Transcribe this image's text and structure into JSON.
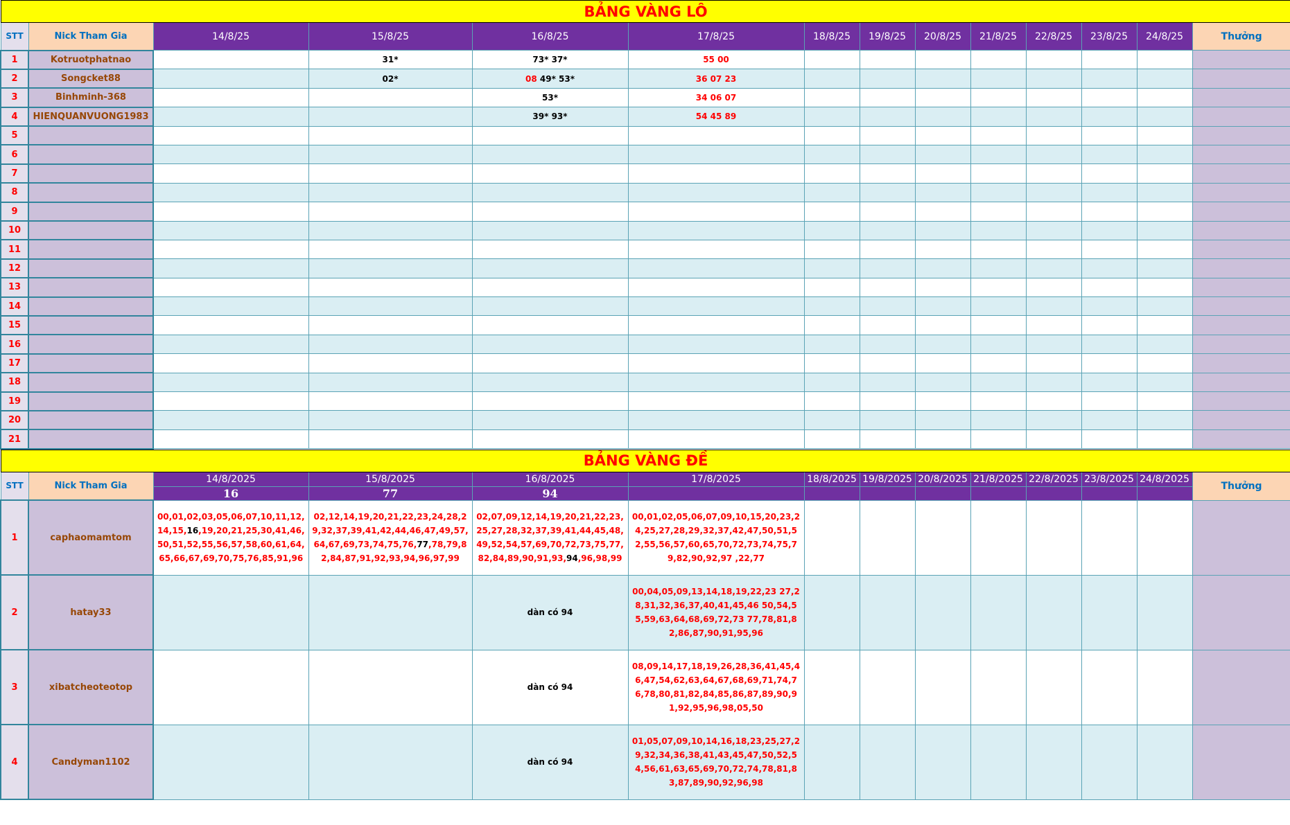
{
  "lo": {
    "title": "BẢNG VÀNG LÔ",
    "hdr_stt": "STT",
    "hdr_nick": "Nick Tham Gia",
    "dates": [
      "14/8/25",
      "15/8/25",
      "16/8/25",
      "17/8/25",
      "18/8/25",
      "19/8/25",
      "20/8/25",
      "21/8/25",
      "22/8/25",
      "23/8/25",
      "24/8/25"
    ],
    "hdr_thuong": "Thưởng",
    "rows": [
      {
        "stt": "1",
        "nick": "Kotruotphatnao",
        "cells": [
          [],
          [
            {
              "t": "31*",
              "c": "blk"
            }
          ],
          [
            {
              "t": "73* 37*",
              "c": "blk"
            }
          ],
          [
            {
              "t": "55 00",
              "c": "red"
            }
          ]
        ]
      },
      {
        "stt": "2",
        "nick": "Songcket88",
        "cells": [
          [],
          [
            {
              "t": "02*",
              "c": "blk"
            }
          ],
          [
            {
              "t": "08",
              "c": "red"
            },
            {
              "t": " 49* 53*",
              "c": "blk"
            }
          ],
          [
            {
              "t": "36 07 23",
              "c": "red"
            }
          ]
        ]
      },
      {
        "stt": "3",
        "nick": "Binhminh-368",
        "cells": [
          [],
          [],
          [
            {
              "t": "53*",
              "c": "blk"
            }
          ],
          [
            {
              "t": "34 06 07",
              "c": "red"
            }
          ]
        ]
      },
      {
        "stt": "4",
        "nick": "HIENQUANVUONG1983",
        "cells": [
          [],
          [],
          [
            {
              "t": "39* 93*",
              "c": "blk"
            }
          ],
          [
            {
              "t": "54 45 89",
              "c": "red"
            }
          ]
        ]
      },
      {
        "stt": "5",
        "nick": "",
        "cells": []
      },
      {
        "stt": "6",
        "nick": "",
        "cells": []
      },
      {
        "stt": "7",
        "nick": "",
        "cells": []
      },
      {
        "stt": "8",
        "nick": "",
        "cells": []
      },
      {
        "stt": "9",
        "nick": "",
        "cells": []
      },
      {
        "stt": "10",
        "nick": "",
        "cells": []
      },
      {
        "stt": "11",
        "nick": "",
        "cells": []
      },
      {
        "stt": "12",
        "nick": "",
        "cells": []
      },
      {
        "stt": "13",
        "nick": "",
        "cells": []
      },
      {
        "stt": "14",
        "nick": "",
        "cells": []
      },
      {
        "stt": "15",
        "nick": "",
        "cells": []
      },
      {
        "stt": "16",
        "nick": "",
        "cells": []
      },
      {
        "stt": "17",
        "nick": "",
        "cells": []
      },
      {
        "stt": "18",
        "nick": "",
        "cells": []
      },
      {
        "stt": "19",
        "nick": "",
        "cells": []
      },
      {
        "stt": "20",
        "nick": "",
        "cells": []
      },
      {
        "stt": "21",
        "nick": "",
        "cells": []
      }
    ]
  },
  "de": {
    "title": "BẢNG VÀNG ĐỀ",
    "hdr_stt": "STT",
    "hdr_nick": "Nick Tham Gia",
    "dates": [
      "14/8/2025",
      "15/8/2025",
      "16/8/2025",
      "17/8/2025",
      "18/8/2025",
      "19/8/2025",
      "20/8/2025",
      "21/8/2025",
      "22/8/2025",
      "23/8/2025",
      "24/8/2025"
    ],
    "results": [
      "16",
      "77",
      "94",
      "",
      "",
      "",
      "",
      "",
      "",
      "",
      ""
    ],
    "hdr_thuong": "Thưởng",
    "rows": [
      {
        "stt": "1",
        "nick": "caphaomamtom",
        "cells": [
          [
            {
              "t": "00,01,02,03,05,06,07,10,11,12,14,15,",
              "c": "red"
            },
            {
              "t": "16",
              "c": "blk"
            },
            {
              "t": ",19,20,21,25,30,41,46,50,51,52,55,56,57,58,60,61,64,65,66,67,69,70,75,76,85,91,96",
              "c": "red"
            }
          ],
          [
            {
              "t": "02,12,14,19,20,21,22,23,24,28,29,32,37,39,41,42,44,46,47,49,57,64,67,69,73,74,75,76,",
              "c": "red"
            },
            {
              "t": "77",
              "c": "blk"
            },
            {
              "t": ",78,79,82,84,87,91,92,93,94,96,97,99",
              "c": "red"
            }
          ],
          [
            {
              "t": "02,07,09,12,14,19,20,21,22,23,25,27,28,32,37,39,41,44,45,48,49,52,54,57,69,70,72,73,75,77,82,84,89,90,91,93,",
              "c": "red"
            },
            {
              "t": "94",
              "c": "blk"
            },
            {
              "t": ",96,98,99",
              "c": "red"
            }
          ],
          [
            {
              "t": "00,01,02,05,06,07,09,10,15,20,23,24,25,27,28,29,32,37,42,47,50,51,52,55,56,57,60,65,70,72,73,74,75,79,82,90,92,97 ,22,77",
              "c": "red"
            }
          ]
        ]
      },
      {
        "stt": "2",
        "nick": "hatay33",
        "cells": [
          [],
          [],
          [
            {
              "t": "dàn có 94",
              "c": "blk"
            }
          ],
          [
            {
              "t": "00,04,05,09,13,14,18,19,22,23 27,28,31,32,36,37,40,41,45,46 50,54,55,59,63,64,68,69,72,73 77,78,81,82,86,87,90,91,95,96",
              "c": "red"
            }
          ]
        ]
      },
      {
        "stt": "3",
        "nick": "xibatcheoteotop",
        "cells": [
          [],
          [],
          [
            {
              "t": "dàn có 94",
              "c": "blk"
            }
          ],
          [
            {
              "t": "08,09,14,17,18,19,26,28,36,41,45,46,47,54,62,63,64,67,68,69,71,74,76,78,80,81,82,84,85,86,87,89,90,91,92,95,96,98,05,50",
              "c": "red"
            }
          ]
        ]
      },
      {
        "stt": "4",
        "nick": "Candyman1102",
        "cells": [
          [],
          [],
          [
            {
              "t": "dàn có 94",
              "c": "blk"
            }
          ],
          [
            {
              "t": "01,05,07,09,10,14,16,18,23,25,27,29,32,34,36,38,41,43,45,47,50,52,54,56,61,63,65,69,70,72,74,78,81,83,87,89,90,92,96,98",
              "c": "red"
            }
          ]
        ]
      }
    ]
  }
}
